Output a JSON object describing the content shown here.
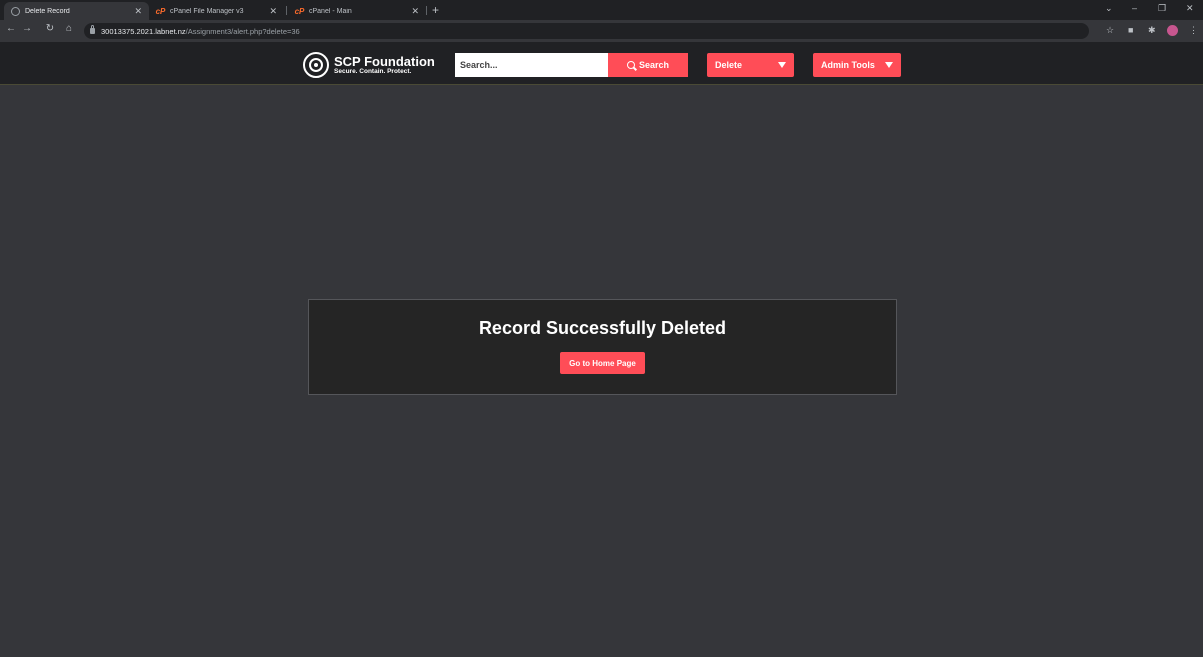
{
  "browser": {
    "tabs": [
      {
        "title": "Delete Record",
        "icon": "globe-icon",
        "active": true
      },
      {
        "title": "cPanel File Manager v3",
        "icon": "cpanel-icon",
        "active": false
      },
      {
        "title": "cPanel - Main",
        "icon": "cpanel-icon",
        "active": false
      }
    ],
    "url_host": "30013375.2021.labnet.nz",
    "url_path": "/Assignment3/alert.php?delete=36"
  },
  "site": {
    "logo_title": "SCP Foundation",
    "logo_tagline": "Secure. Contain. Protect.",
    "search_placeholder": "Search...",
    "search_label": "Search",
    "delete_label": "Delete",
    "admin_label": "Admin Tools"
  },
  "alert": {
    "title": "Record Successfully Deleted",
    "button_label": "Go to Home Page"
  },
  "colors": {
    "accent": "#ff4d57",
    "navbar": "#202124",
    "page_bg": "#35363a",
    "card_bg": "#252525"
  }
}
